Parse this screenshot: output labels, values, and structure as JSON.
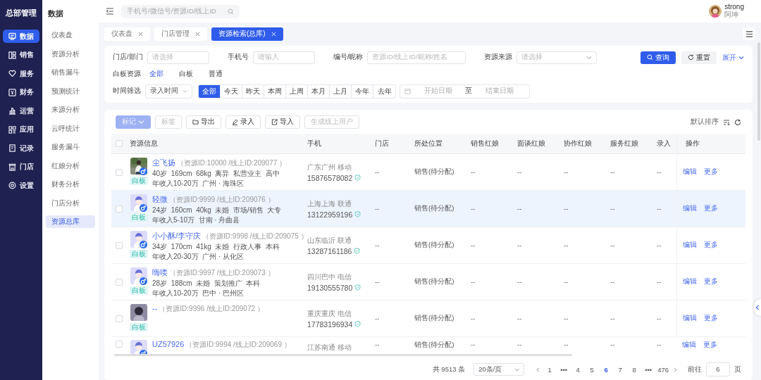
{
  "brand": "总部管理",
  "nav": [
    {
      "label": "数据",
      "selected": true
    },
    {
      "label": "销售",
      "selected": false
    },
    {
      "label": "服务",
      "selected": false
    },
    {
      "label": "财务",
      "selected": false
    },
    {
      "label": "运营",
      "selected": false
    },
    {
      "label": "应用",
      "selected": false
    },
    {
      "label": "记录",
      "selected": false
    },
    {
      "label": "门店",
      "selected": false
    },
    {
      "label": "设置",
      "selected": false
    }
  ],
  "subnav": {
    "title": "数据",
    "items": [
      {
        "label": "仪表盘",
        "selected": false
      },
      {
        "label": "资源分析",
        "selected": false
      },
      {
        "label": "销售漏斗",
        "selected": false
      },
      {
        "label": "预测统计",
        "selected": false
      },
      {
        "label": "来源分析",
        "selected": false
      },
      {
        "label": "云呼统计",
        "selected": false
      },
      {
        "label": "服务漏斗",
        "selected": false
      },
      {
        "label": "红娘分析",
        "selected": false
      },
      {
        "label": "财务分析",
        "selected": false
      },
      {
        "label": "门店分析",
        "selected": false
      },
      {
        "label": "资源总库",
        "selected": true
      }
    ]
  },
  "topbar": {
    "search_placeholder": "手机号/微信号/资源ID/线上ID",
    "user": {
      "name": "strong",
      "role": "阿坤"
    }
  },
  "tabs": [
    {
      "label": "仪表盘",
      "selected": false
    },
    {
      "label": "门店管理",
      "selected": false
    },
    {
      "label": "资源检索(总库)",
      "selected": true
    }
  ],
  "filters": {
    "fields": [
      {
        "label": "门店/部门",
        "placeholder": "请选择",
        "dropdown": false
      },
      {
        "label": "手机号",
        "placeholder": "请输入",
        "dropdown": false
      },
      {
        "label": "编号/昵称",
        "placeholder": "资源ID/线上ID/昵称/姓名",
        "dropdown": false
      },
      {
        "label": "资源来源",
        "placeholder": "请选择",
        "dropdown": true
      }
    ],
    "query": "查询",
    "reset": "重置",
    "expand": "展开",
    "whiteboard": {
      "label": "白板资源",
      "options": [
        {
          "label": "全部",
          "selected": true
        },
        {
          "label": "白板",
          "selected": false
        },
        {
          "label": "普通",
          "selected": false
        }
      ]
    },
    "time": {
      "label": "时间筛选",
      "select": "录入时间",
      "ranges": [
        {
          "label": "全部",
          "selected": true
        },
        {
          "label": "今天",
          "selected": false
        },
        {
          "label": "昨天",
          "selected": false
        },
        {
          "label": "本周",
          "selected": false
        },
        {
          "label": "上周",
          "selected": false
        },
        {
          "label": "本月",
          "selected": false
        },
        {
          "label": "上月",
          "selected": false
        },
        {
          "label": "今年",
          "selected": false
        },
        {
          "label": "去年",
          "selected": false
        }
      ],
      "start_placeholder": "开始日期",
      "separator": "至",
      "end_placeholder": "结束日期"
    }
  },
  "toolbar": {
    "buttons": [
      {
        "label": "标记",
        "kind": "dropdown",
        "disabled": true
      },
      {
        "label": "标签",
        "kind": "plain",
        "disabled": true
      },
      {
        "label": "导出",
        "kind": "folder",
        "disabled": false
      },
      {
        "label": "录入",
        "kind": "pen",
        "disabled": false
      },
      {
        "label": "导入",
        "kind": "import",
        "disabled": false
      },
      {
        "label": "生成线上用户",
        "kind": "plain",
        "disabled": true
      }
    ],
    "sort": "默认排序"
  },
  "table": {
    "all_checked": false,
    "columns": [
      "资源信息",
      "手机",
      "门店",
      "所处位置",
      "销售红娘",
      "面谈红娘",
      "协作红娘",
      "服务红娘",
      "录入",
      "操作"
    ],
    "rows": [
      {
        "checked": false,
        "highlighted": false,
        "male": true,
        "name": "尘飞扬",
        "ids": "（资源ID:10000 /线上ID:209077 ）",
        "details": [
          "40岁  169cm  68kg  离异  私营业主  高中",
          "年收入10-20万  广州 · 海珠区"
        ],
        "tag": "白板",
        "region": "广东广州 移动",
        "phone": "15876578082",
        "verified": true,
        "values": [
          "--",
          "销售(待分配)",
          "--",
          "--",
          "--",
          "--",
          "--"
        ],
        "actions": [
          "编辑",
          "更多"
        ]
      },
      {
        "kind": "cartoon",
        "checked": false,
        "highlighted": true,
        "male": true,
        "name": "轻微",
        "ids": "（资源ID:9999 /线上ID:209076 ）",
        "details": [
          "24岁  160cm  40kg  未婚  市场/销售  大专",
          "年收入5-10万  甘南 · 舟曲县"
        ],
        "tag": "白板",
        "region": "上海上海 联通",
        "phone": "13122959196",
        "verified": true,
        "values": [
          "--",
          "销售(待分配)",
          "--",
          "--",
          "--",
          "--",
          "--"
        ],
        "actions": [
          "编辑",
          "更多"
        ]
      },
      {
        "kind": "cartoon",
        "checked": false,
        "highlighted": false,
        "male": true,
        "name": "小小酥/李守庆",
        "ids": "（资源ID:9998 /线上ID:209075 ）",
        "details": [
          "34岁  170cm  41kg  未婚  行政人事  本科",
          "年收入20-30万  广州 · 从化区"
        ],
        "tag": "白板",
        "region": "山东临沂 联通",
        "phone": "13287161186",
        "verified": true,
        "values": [
          "--",
          "销售(待分配)",
          "--",
          "--",
          "--",
          "--",
          "--"
        ],
        "actions": [
          "编辑",
          "更多"
        ]
      },
      {
        "kind": "cartoon",
        "checked": false,
        "highlighted": false,
        "male": true,
        "name": "嗨喽",
        "ids": "（资源ID:9997 /线上ID:209073 ）",
        "details": [
          "28岁  188cm  未婚  策划推广  本科",
          "年收入10-20万  巴中 · 巴州区"
        ],
        "tag": "白板",
        "region": "四川巴中 电信",
        "phone": "19130555780",
        "verified": true,
        "values": [
          "--",
          "销售(待分配)",
          "--",
          "--",
          "--",
          "--",
          "--"
        ],
        "actions": [
          "编辑",
          "更多"
        ]
      },
      {
        "kind": "unknown",
        "checked": false,
        "highlighted": false,
        "male": false,
        "name": "--",
        "ids": "（资源ID:9996 /线上ID:209072 ）",
        "details": [],
        "tag": "白板",
        "region": "重庆重庆 电信",
        "phone": "17783196934",
        "verified": true,
        "values": [
          "--",
          "销售(待分配)",
          "--",
          "--",
          "--",
          "--",
          "--"
        ],
        "actions": [
          "编辑",
          "更多"
        ]
      },
      {
        "kind": "cartoon",
        "checked": false,
        "highlighted": false,
        "male": true,
        "name": "UZ57926",
        "ids": "（资源ID:9994 /线上ID:209069 ）",
        "details": [],
        "region": "江苏南通 移动",
        "values": [
          "--",
          "销售(待分配)",
          "--",
          "--",
          "--",
          "--",
          "--"
        ],
        "actions": [
          "编辑",
          "更多"
        ]
      }
    ]
  },
  "pagination": {
    "total": "共 9513 条",
    "page_size": "20条/页",
    "pages": [
      {
        "label": "1",
        "selected": false
      },
      {
        "label": "•••",
        "selected": false
      },
      {
        "label": "4",
        "selected": false
      },
      {
        "label": "5",
        "selected": false
      },
      {
        "label": "6",
        "selected": true
      },
      {
        "label": "7",
        "selected": false
      },
      {
        "label": "8",
        "selected": false
      },
      {
        "label": "•••",
        "selected": false
      },
      {
        "label": "476",
        "selected": false
      }
    ],
    "goto_label": "前往",
    "goto_value": "6",
    "goto_suffix": "页"
  }
}
